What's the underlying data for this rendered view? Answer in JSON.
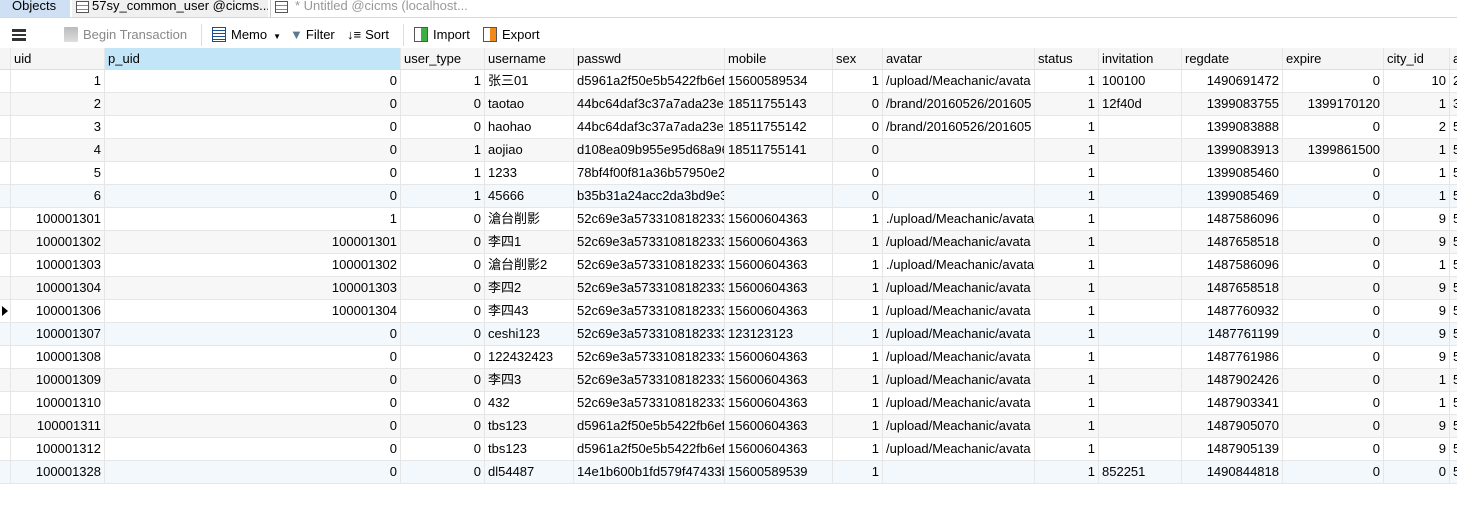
{
  "tabs": [
    {
      "label": "Objects"
    },
    {
      "label": "57sy_common_user @cicms..."
    },
    {
      "label": "* Untitled @cicms (localhost..."
    }
  ],
  "toolbar": {
    "menu_icon": "hamburger-icon",
    "begin_transaction": "Begin Transaction",
    "memo": "Memo",
    "filter": "Filter",
    "sort": "Sort",
    "import": "Import",
    "export": "Export"
  },
  "colors": {
    "selected_header": "#c2e6f8",
    "objects_tab": "#cfe0f4"
  },
  "table": {
    "columns": [
      "uid",
      "p_uid",
      "user_type",
      "username",
      "passwd",
      "mobile",
      "sex",
      "avatar",
      "status",
      "invitation",
      "regdate",
      "expire",
      "city_id",
      "a"
    ],
    "current_row": 10,
    "rows": [
      [
        "1",
        "0",
        "1",
        "张三01",
        "d5961a2f50e5b5422fb6ef",
        "15600589534",
        "1",
        "/upload/Meachanic/avata",
        "1",
        "100100",
        "1490691472",
        "0",
        "10",
        "2"
      ],
      [
        "2",
        "0",
        "0",
        "taotao",
        "44bc64daf3c37a7ada23e(",
        "18511755143",
        "0",
        "/brand/20160526/201605",
        "1",
        "12f40d",
        "1399083755",
        "1399170120",
        "1",
        "3"
      ],
      [
        "3",
        "0",
        "0",
        "haohao",
        "44bc64daf3c37a7ada23e(",
        "18511755142",
        "0",
        "/brand/20160526/201605",
        "1",
        "",
        "1399083888",
        "0",
        "2",
        "5"
      ],
      [
        "4",
        "0",
        "1",
        "aojiao",
        "d108ea09b955e95d68a96",
        "18511755141",
        "0",
        "",
        "1",
        "",
        "1399083913",
        "1399861500",
        "1",
        "5"
      ],
      [
        "5",
        "0",
        "1",
        "1233",
        "78bf4f00f81a36b57950e2",
        "",
        "0",
        "",
        "1",
        "",
        "1399085460",
        "0",
        "1",
        "5"
      ],
      [
        "6",
        "0",
        "1",
        "45666",
        "b35b31a24acc2da3bd9e3",
        "",
        "0",
        "",
        "1",
        "",
        "1399085469",
        "0",
        "1",
        "5"
      ],
      [
        "100001301",
        "1",
        "0",
        "滄台削影",
        "52c69e3a5733108182333",
        "15600604363",
        "1",
        "./upload/Meachanic/avata",
        "1",
        "",
        "1487586096",
        "0",
        "9",
        "5"
      ],
      [
        "100001302",
        "100001301",
        "0",
        "李四1",
        "52c69e3a5733108182333",
        "15600604363",
        "1",
        "/upload/Meachanic/avata",
        "1",
        "",
        "1487658518",
        "0",
        "9",
        "5"
      ],
      [
        "100001303",
        "100001302",
        "0",
        "滄台削影2",
        "52c69e3a5733108182333",
        "15600604363",
        "1",
        "./upload/Meachanic/avata",
        "1",
        "",
        "1487586096",
        "0",
        "1",
        "5"
      ],
      [
        "100001304",
        "100001303",
        "0",
        "李四2",
        "52c69e3a5733108182333",
        "15600604363",
        "1",
        "/upload/Meachanic/avata",
        "1",
        "",
        "1487658518",
        "0",
        "9",
        "5"
      ],
      [
        "100001306",
        "100001304",
        "0",
        "李四43",
        "52c69e3a5733108182333",
        "15600604363",
        "1",
        "/upload/Meachanic/avata",
        "1",
        "",
        "1487760932",
        "0",
        "9",
        "5"
      ],
      [
        "100001307",
        "0",
        "0",
        "ceshi123",
        "52c69e3a5733108182333",
        "123123123",
        "1",
        "/upload/Meachanic/avata",
        "1",
        "",
        "1487761199",
        "0",
        "9",
        "5"
      ],
      [
        "100001308",
        "0",
        "0",
        "122432423",
        "52c69e3a5733108182333",
        "15600604363",
        "1",
        "/upload/Meachanic/avata",
        "1",
        "",
        "1487761986",
        "0",
        "9",
        "5"
      ],
      [
        "100001309",
        "0",
        "0",
        "李四3",
        "52c69e3a5733108182333",
        "15600604363",
        "1",
        "/upload/Meachanic/avata",
        "1",
        "",
        "1487902426",
        "0",
        "1",
        "5"
      ],
      [
        "100001310",
        "0",
        "0",
        "432",
        "52c69e3a5733108182333",
        "15600604363",
        "1",
        "/upload/Meachanic/avata",
        "1",
        "",
        "1487903341",
        "0",
        "1",
        "5"
      ],
      [
        "100001311",
        "0",
        "0",
        "tbs123",
        "d5961a2f50e5b5422fb6ef",
        "15600604363",
        "1",
        "/upload/Meachanic/avata",
        "1",
        "",
        "1487905070",
        "0",
        "9",
        "5"
      ],
      [
        "100001312",
        "0",
        "0",
        "tbs123",
        "d5961a2f50e5b5422fb6ef",
        "15600604363",
        "1",
        "/upload/Meachanic/avata",
        "1",
        "",
        "1487905139",
        "0",
        "9",
        "5"
      ],
      [
        "100001328",
        "0",
        "0",
        "dl54487",
        "14e1b600b1fd579f47433b",
        "15600589539",
        "1",
        "",
        "1",
        "852251",
        "1490844818",
        "0",
        "0",
        "5"
      ]
    ]
  }
}
